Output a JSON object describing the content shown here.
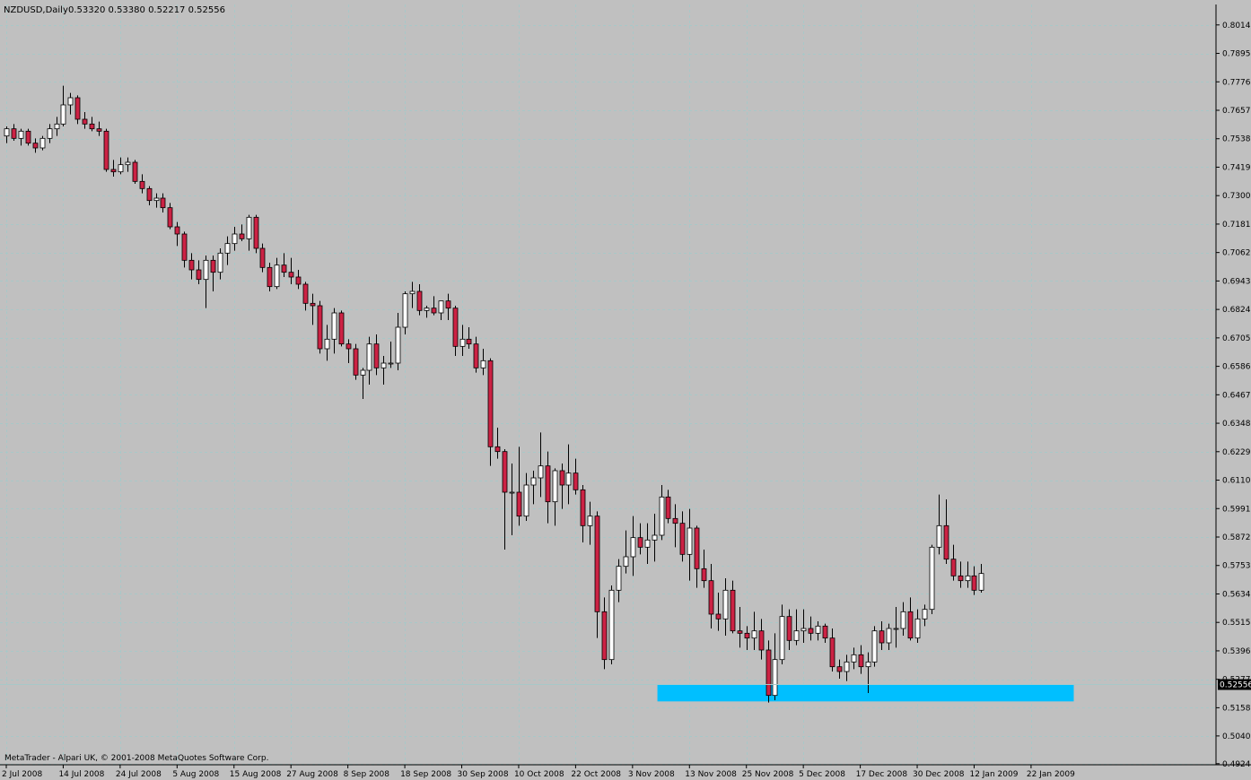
{
  "chart_header": {
    "symbol": "NZDUSD,Daily",
    "ohlc": "0.53320 0.53380 0.52217 0.52556"
  },
  "copyright": "MetaTrader - Alpari UK, © 2001-2008 MetaQuotes Software Corp.",
  "current_price_label": "0.52556",
  "colors": {
    "background": "#c0c0c0",
    "grid": "#a8c8c8",
    "bull_body": "#ffffff",
    "bear_body": "#cc2244",
    "wick": "#000000",
    "zone": "#00bfff"
  },
  "chart_data": {
    "type": "candlestick",
    "title": "NZDUSD,Daily",
    "ylim": [
      0.492,
      0.81
    ],
    "y_ticks": [
      "0.80145",
      "0.78955",
      "0.77765",
      "0.76575",
      "0.75385",
      "0.74195",
      "0.73005",
      "0.71815",
      "0.70625",
      "0.69435",
      "0.68245",
      "0.67055",
      "0.65865",
      "0.64675",
      "0.63485",
      "0.62295",
      "0.61105",
      "0.59915",
      "0.58725",
      "0.57535",
      "0.56345",
      "0.55155",
      "0.53965",
      "0.52775",
      "0.51585",
      "0.50405",
      "0.49245"
    ],
    "x_ticks": [
      {
        "label": "2 Jul 2008",
        "index": 0
      },
      {
        "label": "14 Jul 2008",
        "index": 8
      },
      {
        "label": "24 Jul 2008",
        "index": 16
      },
      {
        "label": "5 Aug 2008",
        "index": 24
      },
      {
        "label": "15 Aug 2008",
        "index": 32
      },
      {
        "label": "27 Aug 2008",
        "index": 40
      },
      {
        "label": "8 Sep 2008",
        "index": 48
      },
      {
        "label": "18 Sep 2008",
        "index": 56
      },
      {
        "label": "30 Sep 2008",
        "index": 64
      },
      {
        "label": "10 Oct 2008",
        "index": 72
      },
      {
        "label": "22 Oct 2008",
        "index": 80
      },
      {
        "label": "3 Nov 2008",
        "index": 88
      },
      {
        "label": "13 Nov 2008",
        "index": 96
      },
      {
        "label": "25 Nov 2008",
        "index": 104
      },
      {
        "label": "5 Dec 2008",
        "index": 112
      },
      {
        "label": "17 Dec 2008",
        "index": 120
      },
      {
        "label": "30 Dec 2008",
        "index": 128
      },
      {
        "label": "12 Jan 2009",
        "index": 136
      },
      {
        "label": "22 Jan 2009",
        "index": 144
      }
    ],
    "support_zone": {
      "top": 0.5256,
      "bottom": 0.5185,
      "start_index": 92,
      "end_index": 150
    },
    "candles": [
      {
        "o": 0.755,
        "h": 0.759,
        "l": 0.752,
        "c": 0.758
      },
      {
        "o": 0.758,
        "h": 0.76,
        "l": 0.753,
        "c": 0.754
      },
      {
        "o": 0.754,
        "h": 0.758,
        "l": 0.751,
        "c": 0.757
      },
      {
        "o": 0.757,
        "h": 0.758,
        "l": 0.751,
        "c": 0.752
      },
      {
        "o": 0.752,
        "h": 0.754,
        "l": 0.748,
        "c": 0.75
      },
      {
        "o": 0.75,
        "h": 0.755,
        "l": 0.749,
        "c": 0.754
      },
      {
        "o": 0.754,
        "h": 0.76,
        "l": 0.752,
        "c": 0.758
      },
      {
        "o": 0.758,
        "h": 0.763,
        "l": 0.755,
        "c": 0.76
      },
      {
        "o": 0.76,
        "h": 0.776,
        "l": 0.759,
        "c": 0.768
      },
      {
        "o": 0.768,
        "h": 0.773,
        "l": 0.764,
        "c": 0.771
      },
      {
        "o": 0.771,
        "h": 0.772,
        "l": 0.76,
        "c": 0.762
      },
      {
        "o": 0.762,
        "h": 0.765,
        "l": 0.758,
        "c": 0.76
      },
      {
        "o": 0.76,
        "h": 0.763,
        "l": 0.757,
        "c": 0.758
      },
      {
        "o": 0.758,
        "h": 0.761,
        "l": 0.755,
        "c": 0.757
      },
      {
        "o": 0.757,
        "h": 0.758,
        "l": 0.74,
        "c": 0.741
      },
      {
        "o": 0.741,
        "h": 0.745,
        "l": 0.738,
        "c": 0.74
      },
      {
        "o": 0.74,
        "h": 0.746,
        "l": 0.739,
        "c": 0.743
      },
      {
        "o": 0.743,
        "h": 0.746,
        "l": 0.74,
        "c": 0.744
      },
      {
        "o": 0.744,
        "h": 0.745,
        "l": 0.735,
        "c": 0.736
      },
      {
        "o": 0.736,
        "h": 0.739,
        "l": 0.731,
        "c": 0.733
      },
      {
        "o": 0.733,
        "h": 0.734,
        "l": 0.726,
        "c": 0.728
      },
      {
        "o": 0.728,
        "h": 0.731,
        "l": 0.725,
        "c": 0.729
      },
      {
        "o": 0.729,
        "h": 0.731,
        "l": 0.723,
        "c": 0.725
      },
      {
        "o": 0.725,
        "h": 0.727,
        "l": 0.716,
        "c": 0.717
      },
      {
        "o": 0.717,
        "h": 0.719,
        "l": 0.709,
        "c": 0.714
      },
      {
        "o": 0.714,
        "h": 0.715,
        "l": 0.7,
        "c": 0.703
      },
      {
        "o": 0.703,
        "h": 0.706,
        "l": 0.695,
        "c": 0.699
      },
      {
        "o": 0.699,
        "h": 0.703,
        "l": 0.693,
        "c": 0.695
      },
      {
        "o": 0.695,
        "h": 0.705,
        "l": 0.683,
        "c": 0.703
      },
      {
        "o": 0.703,
        "h": 0.705,
        "l": 0.69,
        "c": 0.698
      },
      {
        "o": 0.698,
        "h": 0.708,
        "l": 0.695,
        "c": 0.706
      },
      {
        "o": 0.706,
        "h": 0.713,
        "l": 0.701,
        "c": 0.71
      },
      {
        "o": 0.71,
        "h": 0.717,
        "l": 0.707,
        "c": 0.714
      },
      {
        "o": 0.714,
        "h": 0.718,
        "l": 0.711,
        "c": 0.712
      },
      {
        "o": 0.712,
        "h": 0.722,
        "l": 0.707,
        "c": 0.721
      },
      {
        "o": 0.721,
        "h": 0.722,
        "l": 0.706,
        "c": 0.708
      },
      {
        "o": 0.708,
        "h": 0.71,
        "l": 0.698,
        "c": 0.7
      },
      {
        "o": 0.7,
        "h": 0.702,
        "l": 0.69,
        "c": 0.692
      },
      {
        "o": 0.692,
        "h": 0.704,
        "l": 0.691,
        "c": 0.701
      },
      {
        "o": 0.701,
        "h": 0.706,
        "l": 0.696,
        "c": 0.698
      },
      {
        "o": 0.698,
        "h": 0.704,
        "l": 0.693,
        "c": 0.696
      },
      {
        "o": 0.696,
        "h": 0.699,
        "l": 0.691,
        "c": 0.693
      },
      {
        "o": 0.693,
        "h": 0.694,
        "l": 0.682,
        "c": 0.685
      },
      {
        "o": 0.685,
        "h": 0.689,
        "l": 0.676,
        "c": 0.684
      },
      {
        "o": 0.684,
        "h": 0.686,
        "l": 0.664,
        "c": 0.666
      },
      {
        "o": 0.666,
        "h": 0.676,
        "l": 0.661,
        "c": 0.67
      },
      {
        "o": 0.67,
        "h": 0.683,
        "l": 0.664,
        "c": 0.681
      },
      {
        "o": 0.681,
        "h": 0.682,
        "l": 0.667,
        "c": 0.668
      },
      {
        "o": 0.668,
        "h": 0.67,
        "l": 0.66,
        "c": 0.666
      },
      {
        "o": 0.666,
        "h": 0.668,
        "l": 0.653,
        "c": 0.655
      },
      {
        "o": 0.655,
        "h": 0.658,
        "l": 0.645,
        "c": 0.657
      },
      {
        "o": 0.657,
        "h": 0.671,
        "l": 0.651,
        "c": 0.668
      },
      {
        "o": 0.668,
        "h": 0.672,
        "l": 0.655,
        "c": 0.658
      },
      {
        "o": 0.658,
        "h": 0.663,
        "l": 0.651,
        "c": 0.66
      },
      {
        "o": 0.66,
        "h": 0.669,
        "l": 0.658,
        "c": 0.66
      },
      {
        "o": 0.66,
        "h": 0.681,
        "l": 0.657,
        "c": 0.675
      },
      {
        "o": 0.675,
        "h": 0.69,
        "l": 0.672,
        "c": 0.689
      },
      {
        "o": 0.689,
        "h": 0.694,
        "l": 0.683,
        "c": 0.69
      },
      {
        "o": 0.69,
        "h": 0.693,
        "l": 0.68,
        "c": 0.682
      },
      {
        "o": 0.682,
        "h": 0.684,
        "l": 0.679,
        "c": 0.683
      },
      {
        "o": 0.683,
        "h": 0.688,
        "l": 0.68,
        "c": 0.681
      },
      {
        "o": 0.681,
        "h": 0.686,
        "l": 0.678,
        "c": 0.686
      },
      {
        "o": 0.686,
        "h": 0.689,
        "l": 0.678,
        "c": 0.683
      },
      {
        "o": 0.683,
        "h": 0.684,
        "l": 0.663,
        "c": 0.667
      },
      {
        "o": 0.667,
        "h": 0.676,
        "l": 0.663,
        "c": 0.67
      },
      {
        "o": 0.67,
        "h": 0.675,
        "l": 0.666,
        "c": 0.668
      },
      {
        "o": 0.668,
        "h": 0.671,
        "l": 0.656,
        "c": 0.658
      },
      {
        "o": 0.658,
        "h": 0.666,
        "l": 0.655,
        "c": 0.661
      },
      {
        "o": 0.661,
        "h": 0.662,
        "l": 0.617,
        "c": 0.625
      },
      {
        "o": 0.625,
        "h": 0.633,
        "l": 0.62,
        "c": 0.623
      },
      {
        "o": 0.623,
        "h": 0.624,
        "l": 0.582,
        "c": 0.606
      },
      {
        "o": 0.606,
        "h": 0.618,
        "l": 0.588,
        "c": 0.606
      },
      {
        "o": 0.606,
        "h": 0.625,
        "l": 0.592,
        "c": 0.596
      },
      {
        "o": 0.596,
        "h": 0.614,
        "l": 0.594,
        "c": 0.609
      },
      {
        "o": 0.609,
        "h": 0.615,
        "l": 0.601,
        "c": 0.612
      },
      {
        "o": 0.612,
        "h": 0.631,
        "l": 0.604,
        "c": 0.617
      },
      {
        "o": 0.617,
        "h": 0.623,
        "l": 0.593,
        "c": 0.602
      },
      {
        "o": 0.602,
        "h": 0.616,
        "l": 0.592,
        "c": 0.615
      },
      {
        "o": 0.615,
        "h": 0.618,
        "l": 0.599,
        "c": 0.609
      },
      {
        "o": 0.609,
        "h": 0.626,
        "l": 0.601,
        "c": 0.614
      },
      {
        "o": 0.614,
        "h": 0.62,
        "l": 0.605,
        "c": 0.607
      },
      {
        "o": 0.607,
        "h": 0.609,
        "l": 0.585,
        "c": 0.592
      },
      {
        "o": 0.592,
        "h": 0.602,
        "l": 0.584,
        "c": 0.596
      },
      {
        "o": 0.596,
        "h": 0.598,
        "l": 0.545,
        "c": 0.556
      },
      {
        "o": 0.556,
        "h": 0.562,
        "l": 0.532,
        "c": 0.536
      },
      {
        "o": 0.536,
        "h": 0.567,
        "l": 0.534,
        "c": 0.565
      },
      {
        "o": 0.565,
        "h": 0.578,
        "l": 0.56,
        "c": 0.575
      },
      {
        "o": 0.575,
        "h": 0.59,
        "l": 0.572,
        "c": 0.579
      },
      {
        "o": 0.579,
        "h": 0.596,
        "l": 0.571,
        "c": 0.587
      },
      {
        "o": 0.587,
        "h": 0.593,
        "l": 0.58,
        "c": 0.583
      },
      {
        "o": 0.583,
        "h": 0.593,
        "l": 0.576,
        "c": 0.586
      },
      {
        "o": 0.586,
        "h": 0.597,
        "l": 0.577,
        "c": 0.588
      },
      {
        "o": 0.588,
        "h": 0.609,
        "l": 0.586,
        "c": 0.604
      },
      {
        "o": 0.604,
        "h": 0.607,
        "l": 0.593,
        "c": 0.595
      },
      {
        "o": 0.595,
        "h": 0.601,
        "l": 0.583,
        "c": 0.593
      },
      {
        "o": 0.593,
        "h": 0.598,
        "l": 0.577,
        "c": 0.58
      },
      {
        "o": 0.58,
        "h": 0.599,
        "l": 0.569,
        "c": 0.591
      },
      {
        "o": 0.591,
        "h": 0.592,
        "l": 0.566,
        "c": 0.574
      },
      {
        "o": 0.574,
        "h": 0.582,
        "l": 0.566,
        "c": 0.569
      },
      {
        "o": 0.569,
        "h": 0.576,
        "l": 0.549,
        "c": 0.555
      },
      {
        "o": 0.555,
        "h": 0.564,
        "l": 0.548,
        "c": 0.553
      },
      {
        "o": 0.553,
        "h": 0.57,
        "l": 0.546,
        "c": 0.565
      },
      {
        "o": 0.565,
        "h": 0.569,
        "l": 0.547,
        "c": 0.548
      },
      {
        "o": 0.548,
        "h": 0.558,
        "l": 0.541,
        "c": 0.547
      },
      {
        "o": 0.547,
        "h": 0.55,
        "l": 0.54,
        "c": 0.545
      },
      {
        "o": 0.545,
        "h": 0.556,
        "l": 0.54,
        "c": 0.548
      },
      {
        "o": 0.548,
        "h": 0.553,
        "l": 0.536,
        "c": 0.54
      },
      {
        "o": 0.54,
        "h": 0.544,
        "l": 0.518,
        "c": 0.521
      },
      {
        "o": 0.521,
        "h": 0.547,
        "l": 0.519,
        "c": 0.536
      },
      {
        "o": 0.536,
        "h": 0.559,
        "l": 0.534,
        "c": 0.554
      },
      {
        "o": 0.554,
        "h": 0.557,
        "l": 0.54,
        "c": 0.544
      },
      {
        "o": 0.544,
        "h": 0.557,
        "l": 0.542,
        "c": 0.548
      },
      {
        "o": 0.548,
        "h": 0.557,
        "l": 0.543,
        "c": 0.549
      },
      {
        "o": 0.549,
        "h": 0.554,
        "l": 0.544,
        "c": 0.547
      },
      {
        "o": 0.547,
        "h": 0.552,
        "l": 0.544,
        "c": 0.55
      },
      {
        "o": 0.55,
        "h": 0.551,
        "l": 0.543,
        "c": 0.545
      },
      {
        "o": 0.545,
        "h": 0.549,
        "l": 0.531,
        "c": 0.533
      },
      {
        "o": 0.533,
        "h": 0.536,
        "l": 0.528,
        "c": 0.531
      },
      {
        "o": 0.531,
        "h": 0.538,
        "l": 0.527,
        "c": 0.535
      },
      {
        "o": 0.535,
        "h": 0.541,
        "l": 0.532,
        "c": 0.538
      },
      {
        "o": 0.538,
        "h": 0.542,
        "l": 0.53,
        "c": 0.533
      },
      {
        "o": 0.533,
        "h": 0.539,
        "l": 0.522,
        "c": 0.535
      },
      {
        "o": 0.535,
        "h": 0.55,
        "l": 0.533,
        "c": 0.548
      },
      {
        "o": 0.548,
        "h": 0.552,
        "l": 0.54,
        "c": 0.543
      },
      {
        "o": 0.543,
        "h": 0.551,
        "l": 0.54,
        "c": 0.549
      },
      {
        "o": 0.549,
        "h": 0.558,
        "l": 0.541,
        "c": 0.549
      },
      {
        "o": 0.549,
        "h": 0.56,
        "l": 0.546,
        "c": 0.556
      },
      {
        "o": 0.556,
        "h": 0.562,
        "l": 0.544,
        "c": 0.545
      },
      {
        "o": 0.545,
        "h": 0.557,
        "l": 0.543,
        "c": 0.553
      },
      {
        "o": 0.553,
        "h": 0.559,
        "l": 0.55,
        "c": 0.557
      },
      {
        "o": 0.557,
        "h": 0.584,
        "l": 0.555,
        "c": 0.583
      },
      {
        "o": 0.583,
        "h": 0.605,
        "l": 0.58,
        "c": 0.592
      },
      {
        "o": 0.592,
        "h": 0.603,
        "l": 0.576,
        "c": 0.578
      },
      {
        "o": 0.578,
        "h": 0.584,
        "l": 0.569,
        "c": 0.571
      },
      {
        "o": 0.571,
        "h": 0.577,
        "l": 0.566,
        "c": 0.569
      },
      {
        "o": 0.569,
        "h": 0.577,
        "l": 0.566,
        "c": 0.571
      },
      {
        "o": 0.571,
        "h": 0.575,
        "l": 0.563,
        "c": 0.565
      },
      {
        "o": 0.565,
        "h": 0.576,
        "l": 0.564,
        "c": 0.572
      }
    ]
  }
}
